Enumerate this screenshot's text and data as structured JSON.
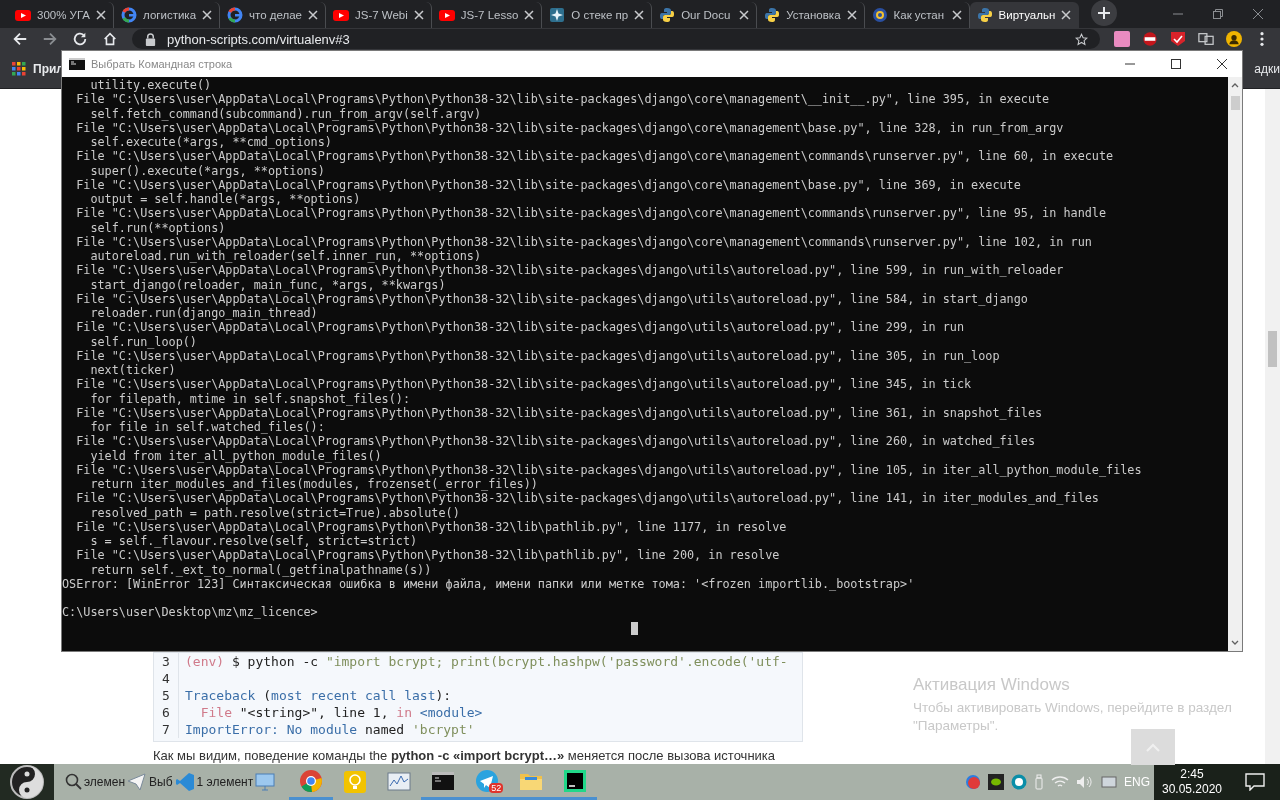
{
  "browser": {
    "tabs": [
      {
        "title": "300% УГА",
        "kind": "youtube",
        "selected": false
      },
      {
        "title": "логистика",
        "kind": "google",
        "selected": false
      },
      {
        "title": "что делае",
        "kind": "google",
        "selected": false
      },
      {
        "title": "JS-7 Webi",
        "kind": "youtube",
        "selected": false
      },
      {
        "title": "JS-7 Lesso",
        "kind": "youtube",
        "selected": false
      },
      {
        "title": "О стеке пр",
        "kind": "star",
        "selected": false
      },
      {
        "title": "Our Docu",
        "kind": "python",
        "selected": false
      },
      {
        "title": "Установка",
        "kind": "python",
        "selected": false
      },
      {
        "title": "Как устан",
        "kind": "round",
        "selected": false
      },
      {
        "title": "Виртуальн",
        "kind": "python",
        "selected": true
      }
    ],
    "address": "python-scripts.com/virtualenv#3",
    "bookmarks": {
      "apps_label": "Прил",
      "other_label": "адки"
    }
  },
  "page": {
    "code_block": {
      "lines": [
        {
          "number": "3",
          "tokens": [
            {
              "kind": "builtin",
              "text": "(env)"
            },
            {
              "kind": "plain",
              "text": " $ python -c "
            },
            {
              "kind": "string",
              "text": "\"import bcrypt; print(bcrypt.hashpw('password'.encode('utf-"
            }
          ]
        },
        {
          "number": "4"
        },
        {
          "number": "5",
          "tokens": [
            {
              "kind": "keyword",
              "text": "Traceback"
            },
            {
              "kind": "plain",
              "text": " ("
            },
            {
              "kind": "keyword",
              "text": "most recent call last"
            },
            {
              "kind": "plain",
              "text": "):"
            }
          ]
        },
        {
          "number": "6",
          "tokens": [
            {
              "kind": "builtin",
              "text": "  File"
            },
            {
              "kind": "plain",
              "text": " \"<string>\", line 1, "
            },
            {
              "kind": "builtin",
              "text": "in"
            },
            {
              "kind": "name",
              "text": " <module>"
            }
          ]
        },
        {
          "number": "7",
          "tokens": [
            {
              "kind": "keyword",
              "text": "ImportError: No module"
            },
            {
              "kind": "plain",
              "text": " named "
            },
            {
              "kind": "string",
              "text": "'bcrypt'"
            }
          ]
        }
      ]
    },
    "paragraph": "Как мы видим, поведение команды the **python -c «import bcrypt…»** меняется после вызова источника"
  },
  "console": {
    "title": "Выбрать Командная строка",
    "lines": [
      "    utility.execute()",
      "  File \"C:\\Users\\user\\AppData\\Local\\Programs\\Python\\Python38-32\\lib\\site-packages\\django\\core\\management\\__init__.py\", line 395, in execute",
      "    self.fetch_command(subcommand).run_from_argv(self.argv)",
      "  File \"C:\\Users\\user\\AppData\\Local\\Programs\\Python\\Python38-32\\lib\\site-packages\\django\\core\\management\\base.py\", line 328, in run_from_argv",
      "    self.execute(*args, **cmd_options)",
      "  File \"C:\\Users\\user\\AppData\\Local\\Programs\\Python\\Python38-32\\lib\\site-packages\\django\\core\\management\\commands\\runserver.py\", line 60, in execute",
      "    super().execute(*args, **options)",
      "  File \"C:\\Users\\user\\AppData\\Local\\Programs\\Python\\Python38-32\\lib\\site-packages\\django\\core\\management\\base.py\", line 369, in execute",
      "    output = self.handle(*args, **options)",
      "  File \"C:\\Users\\user\\AppData\\Local\\Programs\\Python\\Python38-32\\lib\\site-packages\\django\\core\\management\\commands\\runserver.py\", line 95, in handle",
      "    self.run(**options)",
      "  File \"C:\\Users\\user\\AppData\\Local\\Programs\\Python\\Python38-32\\lib\\site-packages\\django\\core\\management\\commands\\runserver.py\", line 102, in run",
      "    autoreload.run_with_reloader(self.inner_run, **options)",
      "  File \"C:\\Users\\user\\AppData\\Local\\Programs\\Python\\Python38-32\\lib\\site-packages\\django\\utils\\autoreload.py\", line 599, in run_with_reloader",
      "    start_django(reloader, main_func, *args, **kwargs)",
      "  File \"C:\\Users\\user\\AppData\\Local\\Programs\\Python\\Python38-32\\lib\\site-packages\\django\\utils\\autoreload.py\", line 584, in start_django",
      "    reloader.run(django_main_thread)",
      "  File \"C:\\Users\\user\\AppData\\Local\\Programs\\Python\\Python38-32\\lib\\site-packages\\django\\utils\\autoreload.py\", line 299, in run",
      "    self.run_loop()",
      "  File \"C:\\Users\\user\\AppData\\Local\\Programs\\Python\\Python38-32\\lib\\site-packages\\django\\utils\\autoreload.py\", line 305, in run_loop",
      "    next(ticker)",
      "  File \"C:\\Users\\user\\AppData\\Local\\Programs\\Python\\Python38-32\\lib\\site-packages\\django\\utils\\autoreload.py\", line 345, in tick",
      "    for filepath, mtime in self.snapshot_files():",
      "  File \"C:\\Users\\user\\AppData\\Local\\Programs\\Python\\Python38-32\\lib\\site-packages\\django\\utils\\autoreload.py\", line 361, in snapshot_files",
      "    for file in self.watched_files():",
      "  File \"C:\\Users\\user\\AppData\\Local\\Programs\\Python\\Python38-32\\lib\\site-packages\\django\\utils\\autoreload.py\", line 260, in watched_files",
      "    yield from iter_all_python_module_files()",
      "  File \"C:\\Users\\user\\AppData\\Local\\Programs\\Python\\Python38-32\\lib\\site-packages\\django\\utils\\autoreload.py\", line 105, in iter_all_python_module_files",
      "    return iter_modules_and_files(modules, frozenset(_error_files))",
      "  File \"C:\\Users\\user\\AppData\\Local\\Programs\\Python\\Python38-32\\lib\\site-packages\\django\\utils\\autoreload.py\", line 141, in iter_modules_and_files",
      "    resolved_path = path.resolve(strict=True).absolute()",
      "  File \"C:\\Users\\user\\AppData\\Local\\Programs\\Python\\Python38-32\\lib\\pathlib.py\", line 1177, in resolve",
      "    s = self._flavour.resolve(self, strict=strict)",
      "  File \"C:\\Users\\user\\AppData\\Local\\Programs\\Python\\Python38-32\\lib\\pathlib.py\", line 200, in resolve",
      "    return self._ext_to_normal(_getfinalpathname(s))",
      "OSError: [WinError 123] Синтаксическая ошибка в имени файла, имени папки или метке тома: '<frozen importlib._bootstrap>'"
    ],
    "prompt": "C:\\Users\\user\\Desktop\\mz\\mz_licence>"
  },
  "activation": {
    "title": "Активация Windows",
    "text": "Чтобы активировать Windows, перейдите в раздел \"Параметры\"."
  },
  "taskbar": {
    "labels": [
      "элемен",
      "Выб",
      "1 элемент"
    ],
    "apps": [
      {
        "kind": "chrome",
        "running": true
      },
      {
        "kind": "bulb",
        "running": false
      },
      {
        "kind": "monitor",
        "running": false
      },
      {
        "kind": "cmd",
        "running": true
      },
      {
        "kind": "telegram",
        "running": true,
        "badge": "52"
      },
      {
        "kind": "folder",
        "running": true
      },
      {
        "kind": "pycharm",
        "running": true
      }
    ],
    "language": "ENG",
    "time": "2:45",
    "date": "30.05.2020"
  }
}
